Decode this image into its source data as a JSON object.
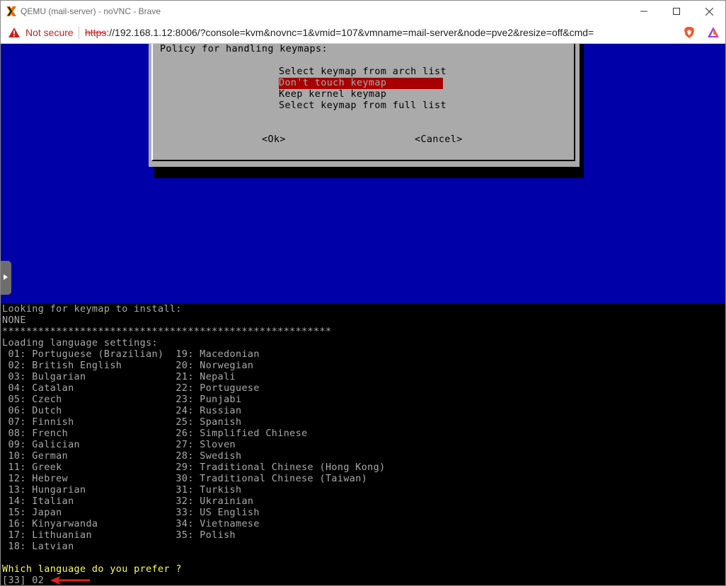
{
  "window": {
    "title": "QEMU (mail-server) - noVNC - Brave"
  },
  "addressbar": {
    "security_label": "Not secure",
    "url_scheme": "https",
    "url_rest": "://192.168.1.12:8006/?console=kvm&novnc=1&vmid=107&vmname=mail-server&node=pve2&resize=off&cmd="
  },
  "dialog": {
    "title": "Policy for handling keymaps:",
    "options": [
      "Select keymap from arch list",
      "Don't touch keymap",
      "Keep kernel keymap",
      "Select keymap from full list"
    ],
    "selected_index": 1,
    "ok_label": "<Ok>",
    "cancel_label": "<Cancel>"
  },
  "terminal": {
    "lines": [
      "Looking for keymap to install:",
      "NONE",
      "*******************************************************",
      "Loading language settings:",
      " 01: Portuguese (Brazilian)  19: Macedonian",
      " 02: British English         20: Norwegian",
      " 03: Bulgarian               21: Nepali",
      " 04: Catalan                 22: Portuguese",
      " 05: Czech                   23: Punjabi",
      " 06: Dutch                   24: Russian",
      " 07: Finnish                 25: Spanish",
      " 08: French                  26: Simplified Chinese",
      " 09: Galician                27: Sloven",
      " 10: German                  28: Swedish",
      " 11: Greek                   29: Traditional Chinese (Hong Kong)",
      " 12: Hebrew                  30: Traditional Chinese (Taiwan)",
      " 13: Hungarian               31: Turkish",
      " 14: Italian                 32: Ukrainian",
      " 15: Japan                   33: US English",
      " 16: Kinyarwanda             34: Vietnamese",
      " 17: Lithuanian              35: Polish",
      " 18: Latvian",
      ""
    ],
    "prompt": "Which language do you prefer ?",
    "input_line": "[33] 02"
  },
  "colors": {
    "console_bg": "#0000a8",
    "dialog_bg": "#aaaaaa",
    "highlight": "#a80000",
    "prompt": "#ffff55",
    "terminal_text": "#aaaaaa",
    "arrow": "#e0201c"
  },
  "icons": {
    "app": "proxmox-x-icon",
    "warning": "warning-triangle-icon",
    "brave": "brave-shields-icon",
    "rewards": "brave-rewards-icon",
    "minimize": "minimize-icon",
    "maximize": "maximize-icon",
    "close": "close-icon",
    "side_handle": "chevron-right-icon",
    "arrow": "red-arrow-annotation-icon"
  }
}
